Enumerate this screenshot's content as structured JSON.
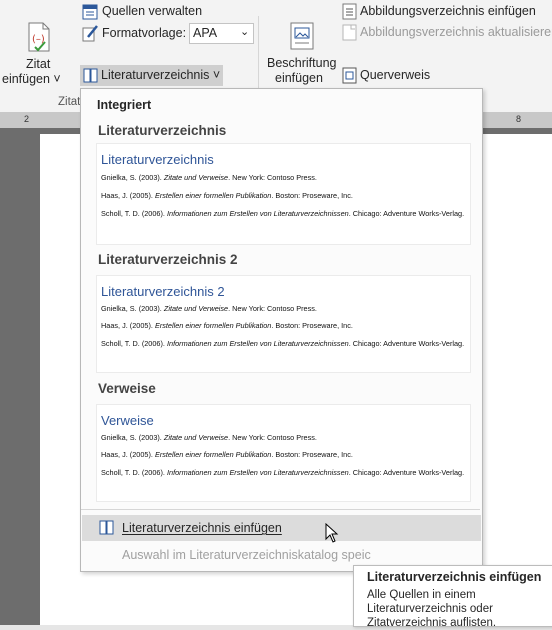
{
  "ribbon": {
    "insert_citation": {
      "line1": "Zitat",
      "line2": "einfügen ˅"
    },
    "manage_sources": "Quellen verwalten",
    "style_label": "Formatvorlage:",
    "style_value": "APA",
    "bibliography_button": "Literaturverzeichnis ˅",
    "group_label_partial": "Zitat",
    "insert_caption": {
      "line1": "Beschriftung",
      "line2": "einfügen"
    },
    "insert_table_of_figures": "Abbildungsverzeichnis einfügen",
    "update_table": "Abbildungsverzeichnis aktualisieren",
    "cross_reference": "Querverweis"
  },
  "ruler": {
    "left_mark": "2",
    "right_mark": "8"
  },
  "gallery": {
    "header": "Integriert",
    "sections": [
      {
        "heading": "Literaturverzeichnis",
        "card_title": "Literaturverzeichnis",
        "entries": [
          {
            "author": "Gnielka, S. (2003). ",
            "title": "Zitate und Verweise",
            "rest": ". New York: Contoso Press."
          },
          {
            "author": "Haas, J. (2005). ",
            "title": "Erstellen einer formellen Publikation",
            "rest": ". Boston: Proseware, Inc."
          },
          {
            "author": "Scholl, T. D. (2006). ",
            "title": "Informationen zum Erstellen von Literaturverzeichnissen",
            "rest": ". Chicago: Adventure Works-Verlag."
          }
        ]
      },
      {
        "heading": "Literaturverzeichnis 2",
        "card_title": "Literaturverzeichnis 2",
        "entries": [
          {
            "author": "Gnielka, S. (2003). ",
            "title": "Zitate und Verweise",
            "rest": ". New York: Contoso Press."
          },
          {
            "author": "Haas, J. (2005). ",
            "title": "Erstellen einer formellen Publikation",
            "rest": ". Boston: Proseware, Inc."
          },
          {
            "author": "Scholl, T. D. (2006). ",
            "title": "Informationen zum Erstellen von Literaturverzeichnissen",
            "rest": ". Chicago: Adventure Works-Verlag."
          }
        ]
      },
      {
        "heading": "Verweise",
        "card_title": "Verweise",
        "entries": [
          {
            "author": "Gnielka, S. (2003). ",
            "title": "Zitate und Verweise",
            "rest": ". New York: Contoso Press."
          },
          {
            "author": "Haas, J. (2005). ",
            "title": "Erstellen einer formellen Publikation",
            "rest": ". Boston: Proseware, Inc."
          },
          {
            "author": "Scholl, T. D. (2006). ",
            "title": "Informationen zum Erstellen von Literaturverzeichnissen",
            "rest": ". Chicago: Adventure Works-Verlag."
          }
        ]
      }
    ],
    "insert_label": "Literaturverzeichnis einfügen",
    "save_label": "Auswahl im Literaturverzeichniskatalog speic"
  },
  "tooltip": {
    "title": "Literaturverzeichnis einfügen",
    "body": "Alle Quellen in einem Literaturverzeichnis oder Zitatverzeichnis auflisten."
  },
  "colors": {
    "accent": "#2f5597",
    "icon_red": "#c0392b",
    "icon_green": "#3c9a3c",
    "icon_blue": "#2b579a"
  },
  "icons": [
    "insert-citation-icon",
    "manage-sources-icon",
    "style-icon",
    "bibliography-icon",
    "insert-caption-icon",
    "table-of-figures-icon",
    "update-table-icon",
    "cross-reference-icon",
    "mouse-cursor-icon"
  ]
}
